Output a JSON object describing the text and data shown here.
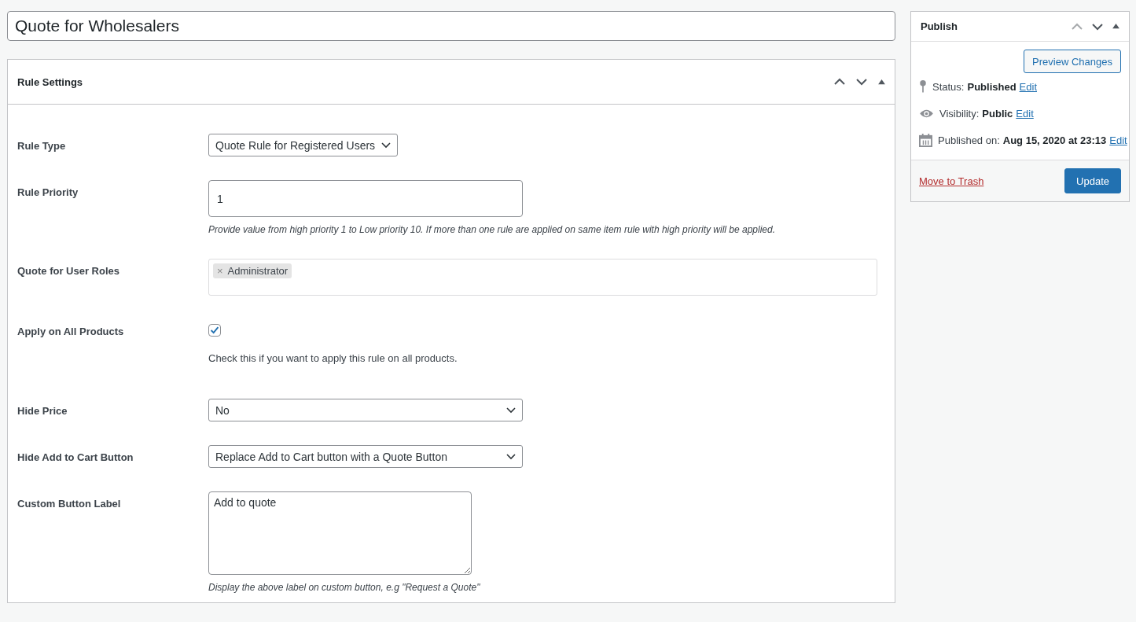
{
  "post_title": {
    "value": "Quote for Wholesalers"
  },
  "rule_settings": {
    "title": "Rule Settings",
    "fields": [
      {
        "kind": "compact_select",
        "label": "Rule Type",
        "value": "Quote Rule for Registered Users"
      },
      {
        "kind": "input",
        "label": "Rule Priority",
        "value": "1",
        "description": "Provide value from high priority 1 to Low priority 10. If more than one rule are applied on same item rule with high priority will be applied."
      },
      {
        "kind": "tags",
        "label": "Quote for User Roles",
        "tags": [
          {
            "remove": "×",
            "label": "Administrator"
          }
        ]
      },
      {
        "kind": "checkbox",
        "label": "Apply on All Products",
        "checked": true,
        "description": "Check this if you want to apply this rule on all products."
      },
      {
        "kind": "select",
        "label": "Hide Price",
        "value": "No"
      },
      {
        "kind": "select",
        "label": "Hide Add to Cart Button",
        "value": "Replace Add to Cart button with a Quote Button"
      },
      {
        "kind": "textarea",
        "label": "Custom Button Label",
        "value": "Add to quote",
        "description": "Display the above label on custom button, e.g \"Request a Quote\""
      }
    ]
  },
  "publish": {
    "title": "Publish",
    "preview_button": "Preview Changes",
    "rows": [
      {
        "kind": "pin",
        "label": "Status:",
        "value": "Published",
        "link": "Edit"
      },
      {
        "kind": "eye",
        "label": "Visibility:",
        "value": "Public",
        "link": "Edit"
      },
      {
        "kind": "calendar",
        "label": "Published on:",
        "value": "Aug 15, 2020 at 23:13",
        "link": "Edit"
      }
    ],
    "trash_link": "Move to Trash",
    "update_button": "Update"
  }
}
